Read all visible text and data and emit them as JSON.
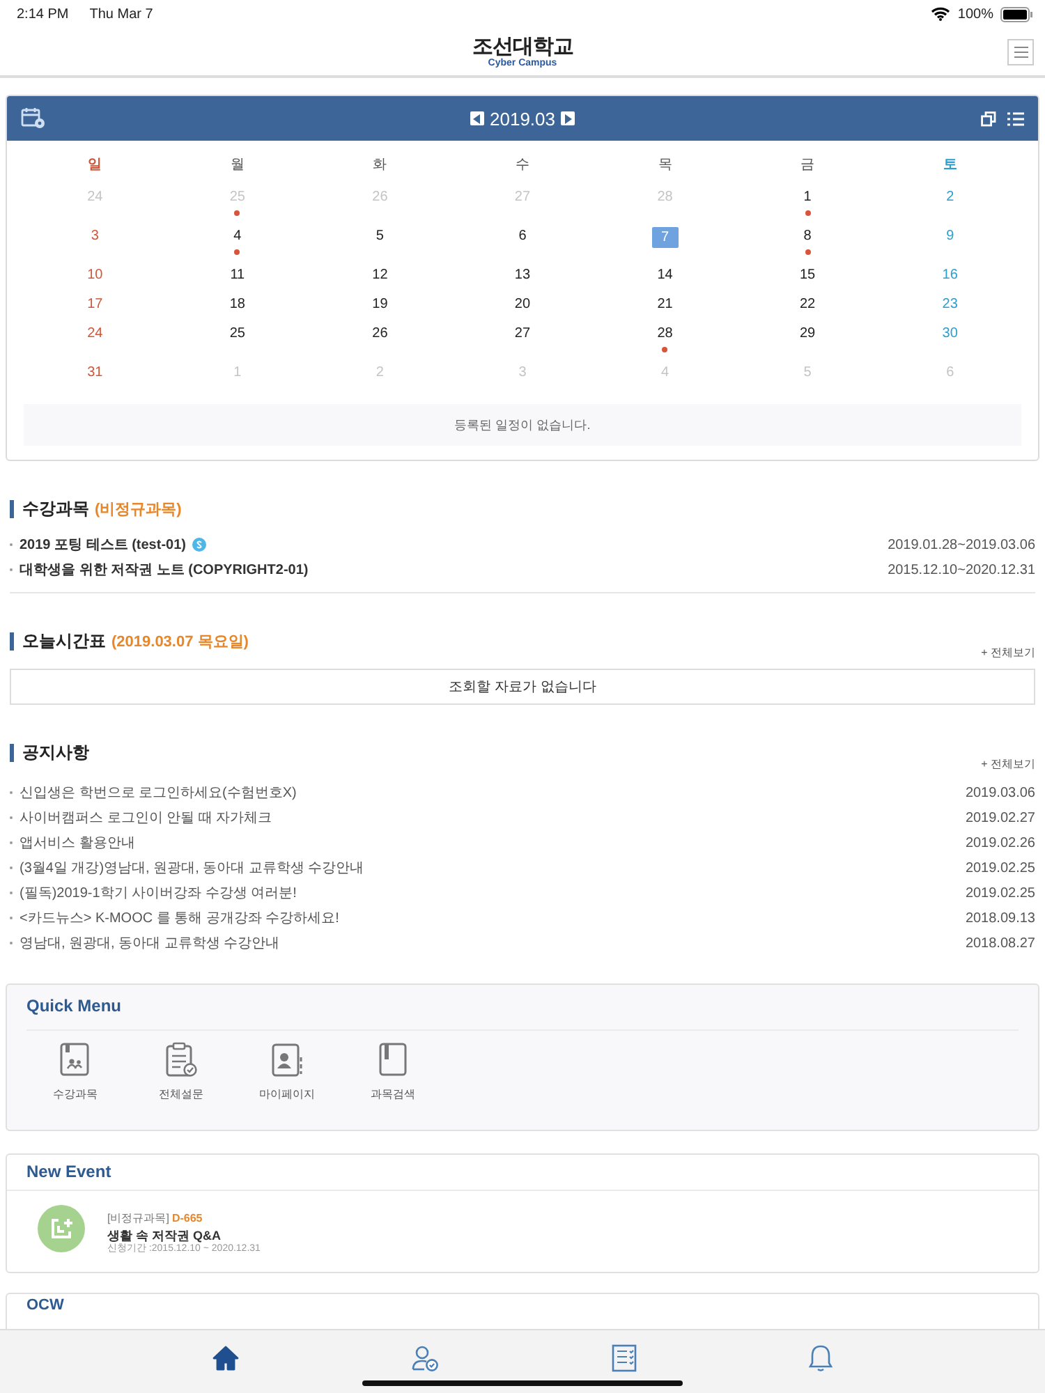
{
  "status_bar": {
    "time": "2:14 PM",
    "date": "Thu Mar 7",
    "battery": "100%"
  },
  "header": {
    "logo": "조선대학교",
    "logo_sub": "Cyber Campus"
  },
  "calendar": {
    "month": "2019.03",
    "weekdays": [
      "일",
      "월",
      "화",
      "수",
      "목",
      "금",
      "토"
    ],
    "weeks": [
      [
        {
          "day": "24",
          "muted": true,
          "event": false,
          "selected": false
        },
        {
          "day": "25",
          "muted": true,
          "event": true,
          "selected": false
        },
        {
          "day": "26",
          "muted": true,
          "event": false,
          "selected": false
        },
        {
          "day": "27",
          "muted": true,
          "event": false,
          "selected": false
        },
        {
          "day": "28",
          "muted": true,
          "event": false,
          "selected": false
        },
        {
          "day": "1",
          "muted": false,
          "event": true,
          "selected": false
        },
        {
          "day": "2",
          "muted": false,
          "event": false,
          "selected": false
        }
      ],
      [
        {
          "day": "3",
          "muted": false,
          "event": false,
          "selected": false
        },
        {
          "day": "4",
          "muted": false,
          "event": true,
          "selected": false
        },
        {
          "day": "5",
          "muted": false,
          "event": false,
          "selected": false
        },
        {
          "day": "6",
          "muted": false,
          "event": false,
          "selected": false
        },
        {
          "day": "7",
          "muted": false,
          "event": false,
          "selected": true
        },
        {
          "day": "8",
          "muted": false,
          "event": true,
          "selected": false
        },
        {
          "day": "9",
          "muted": false,
          "event": false,
          "selected": false
        }
      ],
      [
        {
          "day": "10",
          "muted": false,
          "event": false,
          "selected": false
        },
        {
          "day": "11",
          "muted": false,
          "event": false,
          "selected": false
        },
        {
          "day": "12",
          "muted": false,
          "event": false,
          "selected": false
        },
        {
          "day": "13",
          "muted": false,
          "event": false,
          "selected": false
        },
        {
          "day": "14",
          "muted": false,
          "event": false,
          "selected": false
        },
        {
          "day": "15",
          "muted": false,
          "event": false,
          "selected": false
        },
        {
          "day": "16",
          "muted": false,
          "event": false,
          "selected": false
        }
      ],
      [
        {
          "day": "17",
          "muted": false,
          "event": false,
          "selected": false
        },
        {
          "day": "18",
          "muted": false,
          "event": false,
          "selected": false
        },
        {
          "day": "19",
          "muted": false,
          "event": false,
          "selected": false
        },
        {
          "day": "20",
          "muted": false,
          "event": false,
          "selected": false
        },
        {
          "day": "21",
          "muted": false,
          "event": false,
          "selected": false
        },
        {
          "day": "22",
          "muted": false,
          "event": false,
          "selected": false
        },
        {
          "day": "23",
          "muted": false,
          "event": false,
          "selected": false
        }
      ],
      [
        {
          "day": "24",
          "muted": false,
          "event": false,
          "selected": false
        },
        {
          "day": "25",
          "muted": false,
          "event": false,
          "selected": false
        },
        {
          "day": "26",
          "muted": false,
          "event": false,
          "selected": false
        },
        {
          "day": "27",
          "muted": false,
          "event": false,
          "selected": false
        },
        {
          "day": "28",
          "muted": false,
          "event": true,
          "selected": false
        },
        {
          "day": "29",
          "muted": false,
          "event": false,
          "selected": false
        },
        {
          "day": "30",
          "muted": false,
          "event": false,
          "selected": false
        }
      ],
      [
        {
          "day": "31",
          "muted": false,
          "event": false,
          "selected": false
        },
        {
          "day": "1",
          "muted": true,
          "event": false,
          "selected": false
        },
        {
          "day": "2",
          "muted": true,
          "event": false,
          "selected": false
        },
        {
          "day": "3",
          "muted": true,
          "event": false,
          "selected": false
        },
        {
          "day": "4",
          "muted": true,
          "event": false,
          "selected": false
        },
        {
          "day": "5",
          "muted": true,
          "event": false,
          "selected": false
        },
        {
          "day": "6",
          "muted": true,
          "event": false,
          "selected": false
        }
      ]
    ],
    "empty_message": "등록된 일정이 없습니다."
  },
  "courses": {
    "title": "수강과목",
    "subtitle": "(비정규과목)",
    "items": [
      {
        "name": "2019 포팅 테스트 (test-01)",
        "badge": true,
        "period": "2019.01.28~2019.03.06"
      },
      {
        "name": "대학생을 위한 저작권 노트 (COPYRIGHT2-01)",
        "badge": false,
        "period": "2015.12.10~2020.12.31"
      }
    ]
  },
  "timetable": {
    "title": "오늘시간표",
    "subtitle": "(2019.03.07 목요일)",
    "more": "+ 전체보기",
    "empty_message": "조회할 자료가 없습니다"
  },
  "notices": {
    "title": "공지사항",
    "more": "+ 전체보기",
    "items": [
      {
        "title": "신입생은 학번으로 로그인하세요(수험번호X)",
        "date": "2019.03.06"
      },
      {
        "title": "사이버캠퍼스 로그인이 안될 때 자가체크",
        "date": "2019.02.27"
      },
      {
        "title": "앱서비스 활용안내",
        "date": "2019.02.26"
      },
      {
        "title": "(3월4일 개강)영남대, 원광대, 동아대 교류학생 수강안내",
        "date": "2019.02.25"
      },
      {
        "title": "(필독)2019-1학기 사이버강좌 수강생 여러분!",
        "date": "2019.02.25"
      },
      {
        "title": "<카드뉴스> K-MOOC 를 통해 공개강좌 수강하세요!",
        "date": "2018.09.13"
      },
      {
        "title": "영남대, 원광대, 동아대 교류학생 수강안내",
        "date": "2018.08.27"
      }
    ]
  },
  "quick_menu": {
    "title": "Quick Menu",
    "items": [
      {
        "kind": "course",
        "label": "수강과목"
      },
      {
        "kind": "survey",
        "label": "전체설문"
      },
      {
        "kind": "mypage",
        "label": "마이페이지"
      },
      {
        "kind": "search",
        "label": "과목검색"
      }
    ]
  },
  "new_event": {
    "title": "New Event",
    "items": [
      {
        "category": "[비정규과목]",
        "dday": "D-665",
        "title": "생활 속 저작권 Q&A",
        "period": "신청기간 :2015.12.10 ~ 2020.12.31"
      }
    ]
  },
  "ocw": {
    "title": "OCW"
  },
  "tab_bar": [
    {
      "kind": "home",
      "selected": true
    },
    {
      "kind": "person",
      "selected": false
    },
    {
      "kind": "list",
      "selected": false
    },
    {
      "kind": "bell",
      "selected": false
    }
  ]
}
